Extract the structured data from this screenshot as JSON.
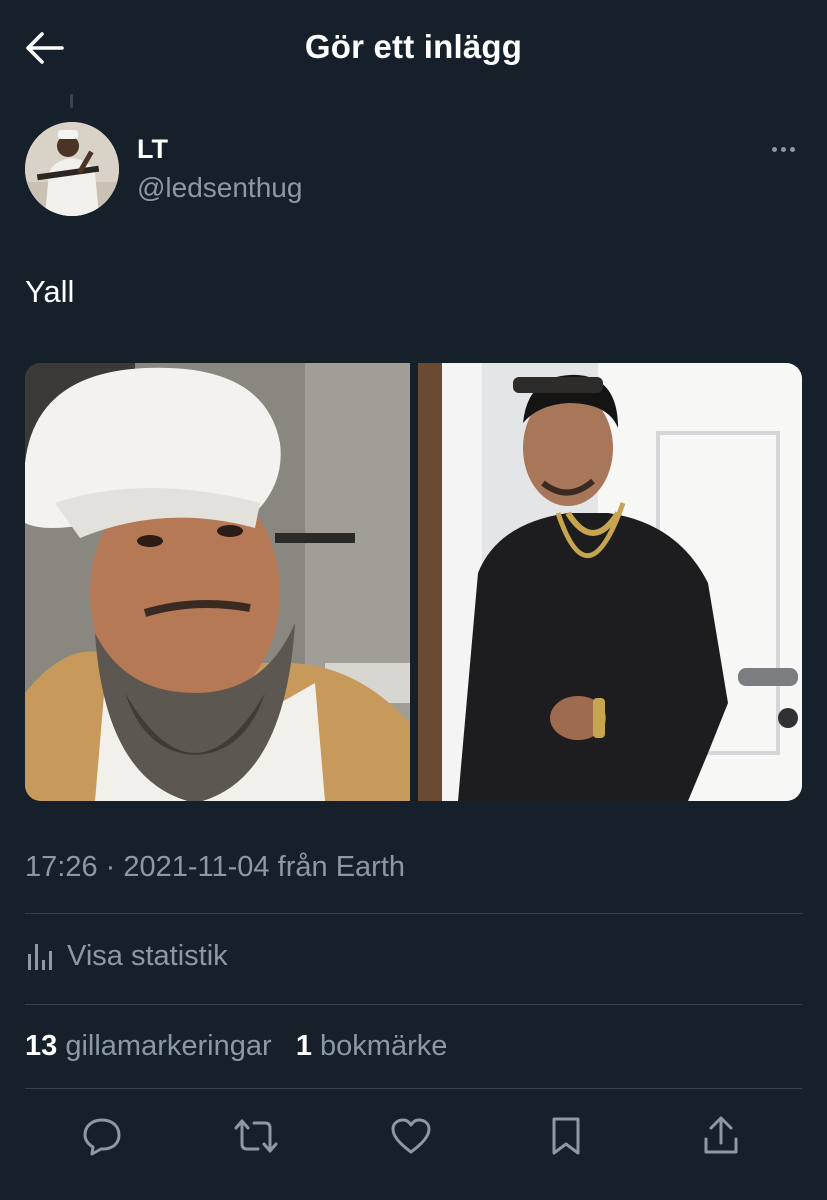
{
  "header": {
    "title": "Gör ett inlägg"
  },
  "post": {
    "author_name": "LT",
    "author_handle": "@ledsenthug",
    "text": "Yall",
    "time": "17:26",
    "date": "2021-11-04",
    "source_prefix": "från",
    "source": "Earth",
    "separator": "·"
  },
  "stats": {
    "view_label": "Visa statistik"
  },
  "engagement": {
    "likes_count": "13",
    "likes_label": "gillamarkeringar",
    "bookmarks_count": "1",
    "bookmarks_label": "bokmärke"
  },
  "actions": [
    {
      "icon": "reply-icon"
    },
    {
      "icon": "retweet-icon"
    },
    {
      "icon": "like-icon"
    },
    {
      "icon": "bookmark-icon"
    },
    {
      "icon": "share-icon"
    }
  ],
  "colors": {
    "background": "#15202b",
    "secondary_text": "#8b98a5",
    "divider": "#38444d",
    "primary_text": "#ffffff"
  }
}
